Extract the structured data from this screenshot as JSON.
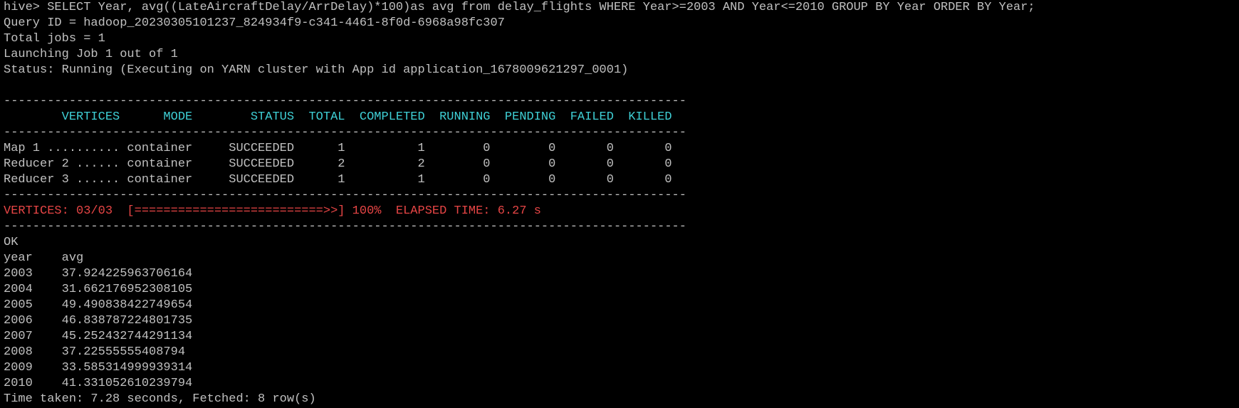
{
  "window": {
    "app": "hive terminal"
  },
  "colors": {
    "background": "#000000",
    "text": "#c0c0c0",
    "header": "#3fd0d6",
    "summary": "#e64545"
  },
  "terminal": {
    "lines": [
      {
        "text": "hive> SELECT Year, avg((LateAircraftDelay/ArrDelay)*100)as avg from delay_flights WHERE Year>=2003 AND Year<=2010 GROUP BY Year ORDER BY Year;",
        "color": "default",
        "name": "hive-command-line"
      },
      {
        "text": "Query ID = hadoop_20230305101237_824934f9-c341-4461-8f0d-6968a98fc307",
        "color": "default",
        "name": "query-id-line"
      },
      {
        "text": "Total jobs = 1",
        "color": "default",
        "name": "total-jobs-line"
      },
      {
        "text": "Launching Job 1 out of 1",
        "color": "default",
        "name": "launching-job-line"
      },
      {
        "text": "Status: Running (Executing on YARN cluster with App id application_1678009621297_0001)",
        "color": "default",
        "name": "status-line"
      },
      {
        "text": "",
        "color": "default",
        "name": "blank-line"
      },
      {
        "text": "----------------------------------------------------------------------------------------------",
        "color": "default",
        "name": "separator-line"
      },
      {
        "text": "        VERTICES      MODE        STATUS  TOTAL  COMPLETED  RUNNING  PENDING  FAILED  KILLED",
        "color": "cyan",
        "name": "vertices-table-header"
      },
      {
        "text": "----------------------------------------------------------------------------------------------",
        "color": "default",
        "name": "separator-line"
      },
      {
        "text": "Map 1 .......... container     SUCCEEDED      1          1        0        0       0       0",
        "color": "default",
        "name": "vertex-row"
      },
      {
        "text": "Reducer 2 ...... container     SUCCEEDED      2          2        0        0       0       0",
        "color": "default",
        "name": "vertex-row"
      },
      {
        "text": "Reducer 3 ...... container     SUCCEEDED      1          1        0        0       0       0",
        "color": "default",
        "name": "vertex-row"
      },
      {
        "text": "----------------------------------------------------------------------------------------------",
        "color": "default",
        "name": "separator-line"
      },
      {
        "text": "VERTICES: 03/03  [==========================>>] 100%  ELAPSED TIME: 6.27 s",
        "color": "red",
        "name": "progress-summary-line"
      },
      {
        "text": "----------------------------------------------------------------------------------------------",
        "color": "default",
        "name": "separator-line"
      },
      {
        "text": "OK",
        "color": "default",
        "name": "ok-line"
      },
      {
        "text": "year    avg",
        "color": "default",
        "name": "result-header"
      },
      {
        "text": "2003    37.924225963706164",
        "color": "default",
        "name": "result-row"
      },
      {
        "text": "2004    31.662176952308105",
        "color": "default",
        "name": "result-row"
      },
      {
        "text": "2005    49.490838422749654",
        "color": "default",
        "name": "result-row"
      },
      {
        "text": "2006    46.838787224801735",
        "color": "default",
        "name": "result-row"
      },
      {
        "text": "2007    45.252432744291134",
        "color": "default",
        "name": "result-row"
      },
      {
        "text": "2008    37.22555555408794",
        "color": "default",
        "name": "result-row"
      },
      {
        "text": "2009    33.585314999939314",
        "color": "default",
        "name": "result-row"
      },
      {
        "text": "2010    41.331052610239794",
        "color": "default",
        "name": "result-row"
      },
      {
        "text": "Time taken: 7.28 seconds, Fetched: 8 row(s)",
        "color": "default",
        "name": "time-taken-line"
      }
    ]
  }
}
